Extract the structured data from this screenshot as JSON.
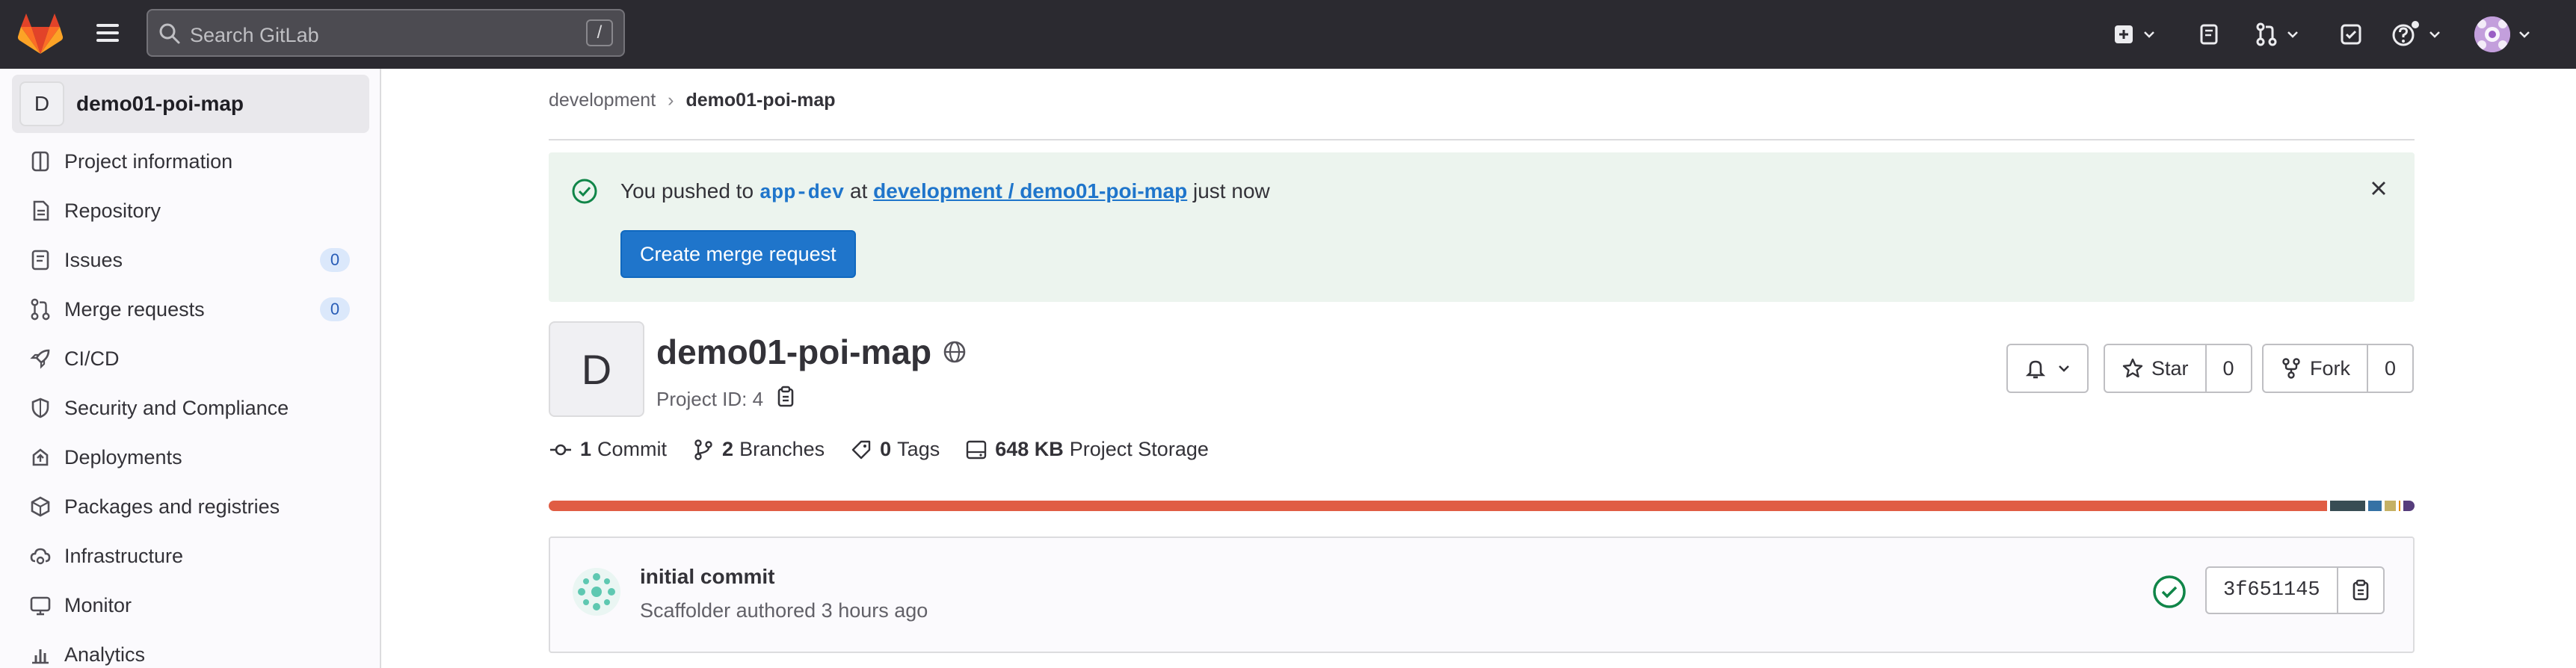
{
  "topbar": {
    "search_placeholder": "Search GitLab",
    "search_shortcut": "/",
    "icons": [
      "gitlab-logo",
      "hamburger-menu",
      "search-icon",
      "new-item-icon",
      "issues-icon",
      "merge-request-icon",
      "todo-icon",
      "help-icon",
      "avatar"
    ]
  },
  "sidebar": {
    "project_letter": "D",
    "project_name": "demo01-poi-map",
    "items": [
      {
        "label": "Project information",
        "icon": "info-icon"
      },
      {
        "label": "Repository",
        "icon": "document-icon"
      },
      {
        "label": "Issues",
        "icon": "issues-icon",
        "badge": "0"
      },
      {
        "label": "Merge requests",
        "icon": "merge-request-icon",
        "badge": "0"
      },
      {
        "label": "CI/CD",
        "icon": "rocket-icon"
      },
      {
        "label": "Security and Compliance",
        "icon": "shield-icon"
      },
      {
        "label": "Deployments",
        "icon": "deployments-icon"
      },
      {
        "label": "Packages and registries",
        "icon": "package-icon"
      },
      {
        "label": "Infrastructure",
        "icon": "cloud-gear-icon"
      },
      {
        "label": "Monitor",
        "icon": "monitor-icon"
      },
      {
        "label": "Analytics",
        "icon": "chart-icon"
      }
    ]
  },
  "breadcrumb": {
    "parent": "development",
    "current": "demo01-poi-map"
  },
  "alert": {
    "prefix": "You pushed to",
    "branch": "app-dev",
    "at": "at",
    "project_link": "development / demo01-poi-map",
    "suffix": "just now",
    "button": "Create merge request"
  },
  "project": {
    "letter": "D",
    "name": "demo01-poi-map",
    "id_text": "Project ID: 4",
    "star_label": "Star",
    "star_count": "0",
    "fork_label": "Fork",
    "fork_count": "0"
  },
  "stats": {
    "commits_num": "1",
    "commits_label": "Commit",
    "branches_num": "2",
    "branches_label": "Branches",
    "tags_num": "0",
    "tags_label": "Tags",
    "storage_num": "648 KB",
    "storage_label": "Project Storage"
  },
  "languages": [
    {
      "color": "#e05d44",
      "fraction": 0.955
    },
    {
      "color": "#384d54",
      "fraction": 0.019
    },
    {
      "color": "#3572a5",
      "fraction": 0.007
    },
    {
      "color": "#c5b165",
      "fraction": 0.006
    },
    {
      "color": "#e38c00",
      "fraction": 0.001
    },
    {
      "color": "#563d7c",
      "fraction": 0.006
    }
  ],
  "commit": {
    "title": "initial commit",
    "meta": "Scaffolder authored 3 hours ago",
    "sha": "3f651145",
    "status": "success"
  },
  "colors": {
    "accent": "#1f75cb",
    "success": "#108548",
    "topbar": "#2b2a30"
  }
}
